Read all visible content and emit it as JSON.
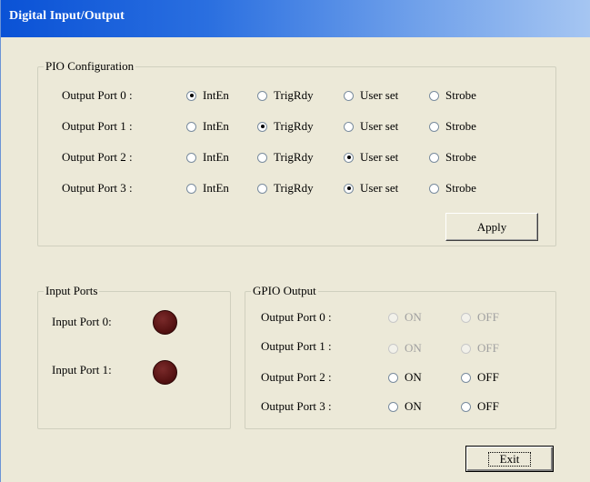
{
  "window": {
    "title": "Digital Input/Output"
  },
  "pio": {
    "label": "PIO Configuration",
    "options": [
      "IntEn",
      "TrigRdy",
      "User set",
      "Strobe"
    ],
    "ports": [
      {
        "label": "Output Port 0 :",
        "selected": "IntEn"
      },
      {
        "label": "Output Port 1 :",
        "selected": "TrigRdy"
      },
      {
        "label": "Output Port 2 :",
        "selected": "User set"
      },
      {
        "label": "Output Port 3 :",
        "selected": "User set"
      }
    ],
    "apply_label": "Apply"
  },
  "input": {
    "label": "Input Ports",
    "ports": [
      {
        "label": "Input Port 0:",
        "led_color": "#5a1515"
      },
      {
        "label": "Input Port 1:",
        "led_color": "#5a1515"
      }
    ]
  },
  "gpio": {
    "label": "GPIO Output",
    "on_label": "ON",
    "off_label": "OFF",
    "ports": [
      {
        "label": "Output Port 0 :",
        "enabled": false,
        "selected": null
      },
      {
        "label": "Output Port 1 :",
        "enabled": false,
        "selected": null
      },
      {
        "label": "Output Port 2 :",
        "enabled": true,
        "selected": null
      },
      {
        "label": "Output Port 3 :",
        "enabled": true,
        "selected": null
      }
    ]
  },
  "exit_label": "Exit"
}
